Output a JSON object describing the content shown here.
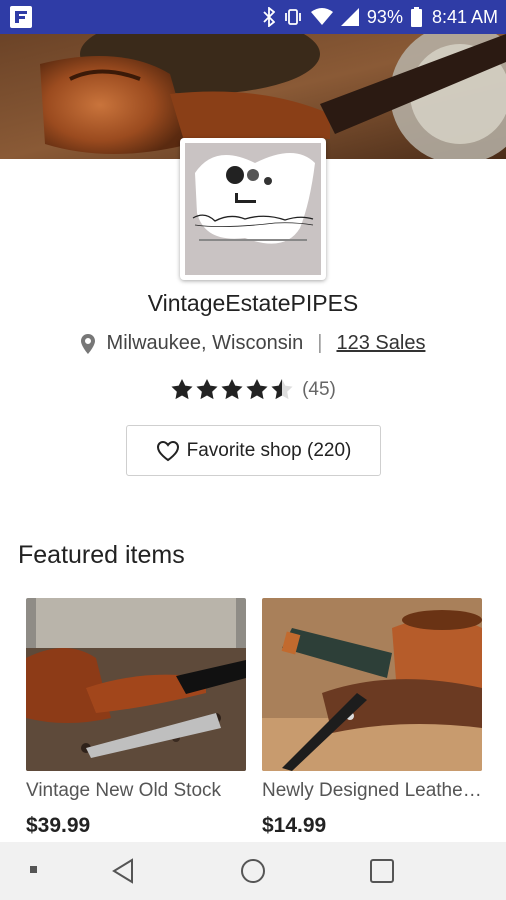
{
  "status_bar": {
    "battery_percent": "93%",
    "time": "8:41 AM",
    "icons": [
      "app-notification-icon",
      "bluetooth-icon",
      "vibrate-icon",
      "wifi-icon",
      "cell-signal-icon",
      "battery-icon"
    ]
  },
  "shop": {
    "name": "VintageEstatePIPES",
    "location": "Milwaukee, Wisconsin",
    "sales": "123 Sales",
    "rating": 4.5,
    "review_count": "(45)",
    "favorite_label": "Favorite shop (220)",
    "logo_text": "Vintage Estate Pipes",
    "logo_subtext": "AMBER ALLEGED PIPES AT LAST EST PRESENT"
  },
  "featured": {
    "title": "Featured items",
    "items": [
      {
        "title": "Vintage New Old Stock",
        "price": "$39.99"
      },
      {
        "title": "Newly Designed Leather Pipe Stand",
        "price": "$14.99"
      }
    ]
  },
  "nav": {
    "buttons": [
      "recent-dot-icon",
      "back-icon",
      "home-icon",
      "overview-icon"
    ]
  },
  "colors": {
    "status_bar": "#2f3ca6",
    "nav_bar": "#f1f1f1",
    "text_primary": "#222222"
  }
}
